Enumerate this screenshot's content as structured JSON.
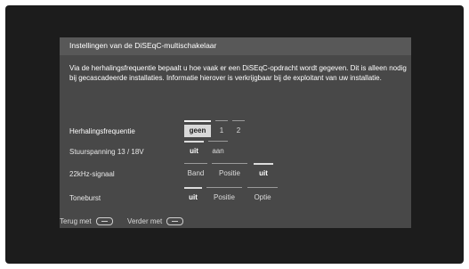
{
  "dialog": {
    "title": "Instellingen van de DiSEqC-multischakelaar",
    "description": "Via de herhalingsfrequentie bepaalt u hoe vaak er een DiSEqC-opdracht wordt gegeven. Dit is alleen nodig bij gecascadeerde installaties. Informatie hierover is verkrijgbaar bij de exploitant van uw installatie."
  },
  "rows": [
    {
      "label": "Herhalingsfrequentie",
      "options": [
        "geen",
        "1",
        "2"
      ],
      "selected": "geen",
      "focused": true
    },
    {
      "label": "Stuurspanning 13 / 18V",
      "options": [
        "uit",
        "aan"
      ],
      "selected": "uit"
    },
    {
      "label": "22kHz-signaal",
      "options": [
        "Band",
        "Positie",
        "uit"
      ],
      "selected": "uit"
    },
    {
      "label": "Toneburst",
      "options": [
        "uit",
        "Positie",
        "Optie"
      ],
      "selected": "uit"
    }
  ],
  "footer": {
    "back_label": "Terug met",
    "next_label": "Verder met",
    "back_icon": "remote-back-icon",
    "next_icon": "remote-ok-icon"
  }
}
